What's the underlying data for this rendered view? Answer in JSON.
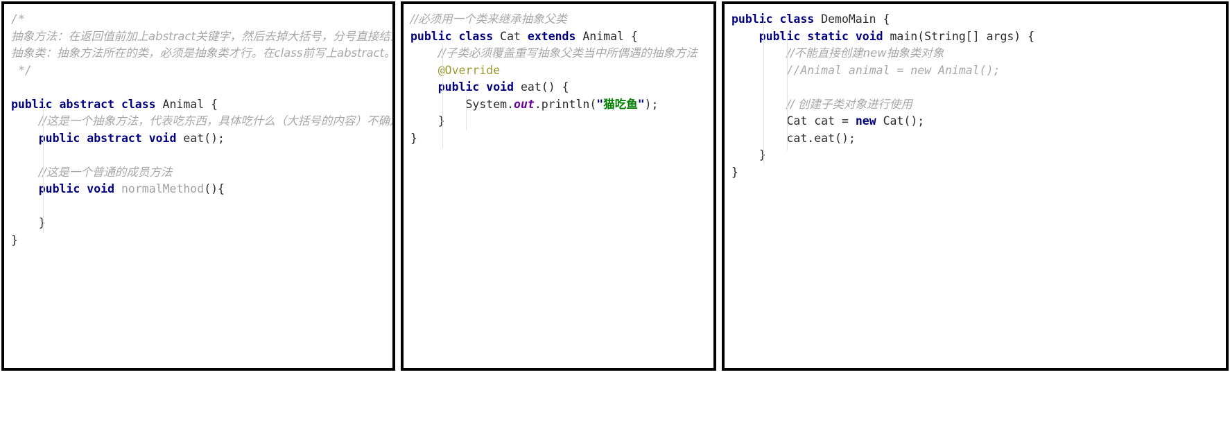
{
  "panels": [
    {
      "name": "animal-class-panel",
      "lines": [
        {
          "id": "a1",
          "tokens": [
            {
              "t": "/*",
              "c": "comment-mono"
            }
          ]
        },
        {
          "id": "a2",
          "tokens": [
            {
              "t": "抽象方法：在返回值前加上abstract关键字，然后去掉大括号，分号直接结束。",
              "c": "comment"
            }
          ]
        },
        {
          "id": "a3",
          "tokens": [
            {
              "t": "抽象类：抽象方法所在的类，必须是抽象类才行。在class前写上abstract。",
              "c": "comment"
            }
          ]
        },
        {
          "id": "a4",
          "tokens": [
            {
              "t": " */",
              "c": "comment-mono"
            }
          ]
        },
        {
          "id": "a5",
          "tokens": []
        },
        {
          "id": "a6",
          "tokens": [
            {
              "t": "public abstract class ",
              "c": "kw"
            },
            {
              "t": "Animal ",
              "c": "plain"
            },
            {
              "t": "{",
              "c": "brace"
            }
          ]
        },
        {
          "id": "a7",
          "tokens": [
            {
              "t": "    ",
              "c": "plain"
            },
            {
              "t": "//这是一个抽象方法，代表吃东西，具体吃什么（大括号的内容）不确定。",
              "c": "comment"
            }
          ]
        },
        {
          "id": "a8",
          "tokens": [
            {
              "t": "    ",
              "c": "plain"
            },
            {
              "t": "public abstract void ",
              "c": "kw"
            },
            {
              "t": "eat();",
              "c": "plain"
            }
          ]
        },
        {
          "id": "a9",
          "tokens": []
        },
        {
          "id": "a10",
          "tokens": [
            {
              "t": "    ",
              "c": "plain"
            },
            {
              "t": "//这是一个普通的成员方法",
              "c": "comment"
            }
          ]
        },
        {
          "id": "a11",
          "tokens": [
            {
              "t": "    ",
              "c": "plain"
            },
            {
              "t": "public void ",
              "c": "kw"
            },
            {
              "t": "normalMethod",
              "c": "dim"
            },
            {
              "t": "(){",
              "c": "plain"
            }
          ]
        },
        {
          "id": "a12",
          "tokens": []
        },
        {
          "id": "a13",
          "tokens": [
            {
              "t": "    }",
              "c": "plain"
            }
          ]
        },
        {
          "id": "a14",
          "tokens": [
            {
              "t": "}",
              "c": "plain"
            }
          ]
        }
      ]
    },
    {
      "name": "cat-class-panel",
      "lines": [
        {
          "id": "c1",
          "tokens": [
            {
              "t": "//必须用一个类来继承抽象父类",
              "c": "comment"
            }
          ]
        },
        {
          "id": "c2",
          "tokens": [
            {
              "t": "public class ",
              "c": "kw"
            },
            {
              "t": "Cat ",
              "c": "plain"
            },
            {
              "t": "extends ",
              "c": "kw"
            },
            {
              "t": "Animal ",
              "c": "plain"
            },
            {
              "t": "{",
              "c": "brace"
            }
          ]
        },
        {
          "id": "c3",
          "tokens": [
            {
              "t": "    ",
              "c": "plain"
            },
            {
              "t": "//子类必须覆盖重写抽象父类当中所偶遇的抽象方法",
              "c": "comment"
            }
          ]
        },
        {
          "id": "c4",
          "tokens": [
            {
              "t": "    ",
              "c": "plain"
            },
            {
              "t": "@Override",
              "c": "anno"
            }
          ]
        },
        {
          "id": "c5",
          "tokens": [
            {
              "t": "    ",
              "c": "plain"
            },
            {
              "t": "public void ",
              "c": "kw"
            },
            {
              "t": "eat() {",
              "c": "plain"
            }
          ]
        },
        {
          "id": "c6",
          "tokens": [
            {
              "t": "        ",
              "c": "plain"
            },
            {
              "t": "System.",
              "c": "plain"
            },
            {
              "t": "out",
              "c": "field"
            },
            {
              "t": ".println(",
              "c": "plain"
            },
            {
              "t": "\"",
              "c": "quote"
            },
            {
              "t": "猫吃鱼",
              "c": "str"
            },
            {
              "t": "\"",
              "c": "quote"
            },
            {
              "t": ");",
              "c": "plain"
            }
          ]
        },
        {
          "id": "c7",
          "tokens": [
            {
              "t": "    }",
              "c": "plain"
            }
          ]
        },
        {
          "id": "c8",
          "tokens": [
            {
              "t": "}",
              "c": "plain"
            }
          ]
        }
      ]
    },
    {
      "name": "demomain-class-panel",
      "lines": [
        {
          "id": "d1",
          "tokens": [
            {
              "t": "public class ",
              "c": "kw"
            },
            {
              "t": "DemoMain ",
              "c": "plain"
            },
            {
              "t": "{",
              "c": "brace"
            }
          ]
        },
        {
          "id": "d2",
          "tokens": [
            {
              "t": "    ",
              "c": "plain"
            },
            {
              "t": "public static void ",
              "c": "kw"
            },
            {
              "t": "main(String[] args) {",
              "c": "plain"
            }
          ]
        },
        {
          "id": "d3",
          "tokens": [
            {
              "t": "        ",
              "c": "plain"
            },
            {
              "t": "//不能直接创建new抽象类对象",
              "c": "comment"
            }
          ]
        },
        {
          "id": "d4",
          "tokens": [
            {
              "t": "        ",
              "c": "plain"
            },
            {
              "t": "//Animal animal = new Animal();",
              "c": "comment-mono"
            }
          ]
        },
        {
          "id": "d5",
          "tokens": []
        },
        {
          "id": "d6",
          "tokens": [
            {
              "t": "        ",
              "c": "plain"
            },
            {
              "t": "// 创建子类对象进行使用",
              "c": "comment"
            }
          ]
        },
        {
          "id": "d7",
          "tokens": [
            {
              "t": "        ",
              "c": "plain"
            },
            {
              "t": "Cat cat = ",
              "c": "plain"
            },
            {
              "t": "new ",
              "c": "kw"
            },
            {
              "t": "Cat();",
              "c": "plain"
            }
          ]
        },
        {
          "id": "d8",
          "tokens": [
            {
              "t": "        ",
              "c": "plain"
            },
            {
              "t": "cat.eat();",
              "c": "plain"
            }
          ]
        },
        {
          "id": "d9",
          "tokens": [
            {
              "t": "    }",
              "c": "plain"
            }
          ]
        },
        {
          "id": "d10",
          "tokens": [
            {
              "t": "}",
              "c": "plain"
            }
          ]
        }
      ]
    }
  ],
  "colors": {
    "keyword": "#000080",
    "comment": "#a8a8a8",
    "string": "#008000",
    "annotation": "#9a9a30",
    "static_field": "#660099",
    "plain_text": "#2b2b2b",
    "panel_border": "#000000",
    "background": "#ffffff"
  }
}
